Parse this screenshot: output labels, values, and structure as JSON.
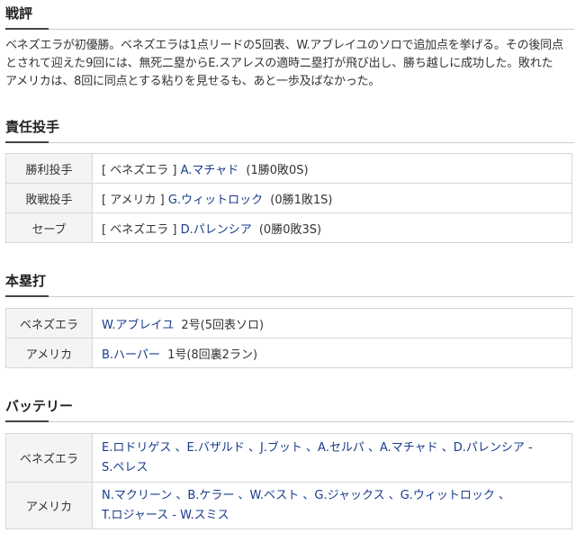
{
  "sections": {
    "commentary_title": "戦評",
    "pitchers_title": "責任投手",
    "homeruns_title": "本塁打",
    "battery_title": "バッテリー"
  },
  "commentary": {
    "line1": "ベネズエラが初優勝。ベネズエラは1点リードの5回表、W.アブレイユのソロで追加点を挙げる。その後同点",
    "line2": "とされて迎えた9回には、無死二塁からE.スアレスの適時二塁打が飛び出し、勝ち越しに成功した。敗れた",
    "line3": "アメリカは、8回に同点とする粘りを見せるも、あと一歩及ばなかった。"
  },
  "pitchers": [
    {
      "label": "勝利投手",
      "team": "[ ベネズエラ ]",
      "player": "A.マチャド",
      "record": "(1勝0敗0S)"
    },
    {
      "label": "敗戦投手",
      "team": "[ アメリカ ]",
      "player": "G.ウィットロック",
      "record": "(0勝1敗1S)"
    },
    {
      "label": "セーブ",
      "team": "[ ベネズエラ ]",
      "player": "D.パレンシア",
      "record": "(0勝0敗3S)"
    }
  ],
  "homeruns": [
    {
      "team": "ベネズエラ",
      "player": "W.アブレイユ",
      "detail": "2号(5回表ソロ)"
    },
    {
      "team": "アメリカ",
      "player": "B.ハーパー",
      "detail": "1号(8回裏2ラン)"
    }
  ],
  "battery": [
    {
      "team": "ベネズエラ",
      "line1": "E.ロドリゲス 、E.バザルド 、J.ブット 、A.セルパ 、A.マチャド 、D.パレンシア -",
      "line2": "S.ペレス"
    },
    {
      "team": "アメリカ",
      "line1": "N.マクリーン 、B.ケラー 、W.ベスト 、G.ジャックス 、G.ウィットロック 、",
      "line2": "T.ロジャース - W.スミス"
    }
  ]
}
